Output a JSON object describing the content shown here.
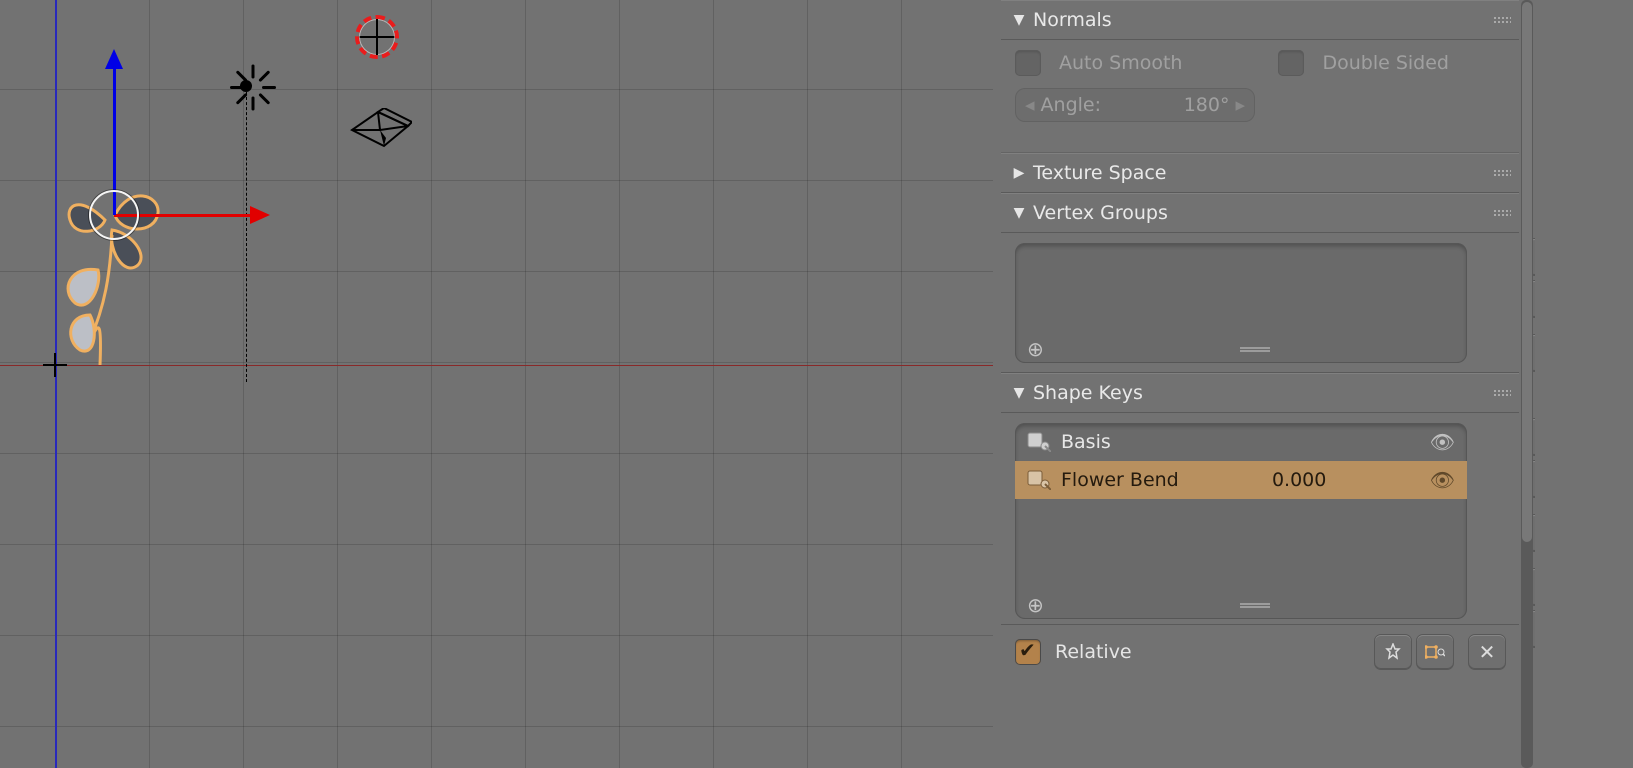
{
  "viewport": {
    "has_grid": true
  },
  "panels": {
    "normals": {
      "title": "Normals",
      "expanded": true,
      "auto_smooth": {
        "label": "Auto Smooth",
        "checked": false
      },
      "double_sided": {
        "label": "Double Sided",
        "checked": false
      },
      "angle": {
        "label": "Angle:",
        "value": "180°"
      }
    },
    "texture_space": {
      "title": "Texture Space",
      "expanded": false
    },
    "vertex_groups": {
      "title": "Vertex Groups",
      "expanded": true,
      "items": []
    },
    "shape_keys": {
      "title": "Shape Keys",
      "expanded": true,
      "items": [
        {
          "name": "Basis",
          "value": null,
          "selected": false
        },
        {
          "name": "Flower Bend",
          "value": "0.000",
          "selected": true
        }
      ],
      "relative": {
        "label": "Relative",
        "checked": true
      }
    }
  }
}
